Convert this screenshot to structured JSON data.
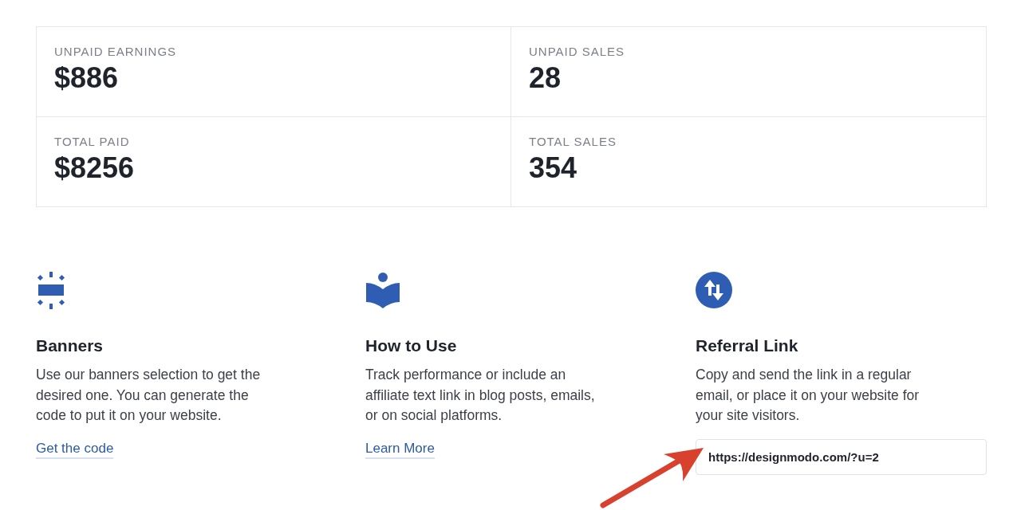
{
  "stats": [
    {
      "label": "UNPAID EARNINGS",
      "value": "$886"
    },
    {
      "label": "UNPAID SALES",
      "value": "28"
    },
    {
      "label": "TOTAL PAID",
      "value": "$8256"
    },
    {
      "label": "TOTAL SALES",
      "value": "354"
    }
  ],
  "features": [
    {
      "kind": "banners",
      "title": "Banners",
      "text": "Use our banners selection to get the desired one. You can generate the code to put it on your website.",
      "link": "Get the code"
    },
    {
      "kind": "guide",
      "title": "How to Use",
      "text": "Track performance or include an affiliate text link in blog posts, emails, or on social platforms.",
      "link": "Learn More"
    },
    {
      "kind": "referral",
      "title": "Referral Link",
      "text": "Copy and send the link in a regular email, or place it on your website for your site visitors.",
      "field": {
        "value": "https://designmodo.com/?u=2"
      }
    }
  ]
}
